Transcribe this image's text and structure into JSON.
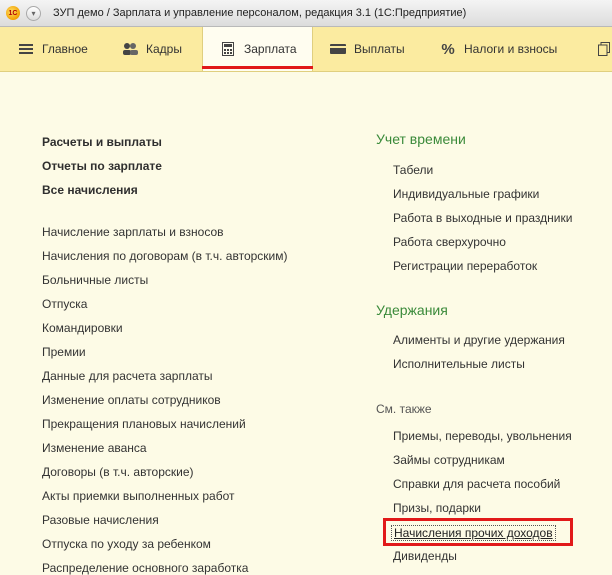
{
  "window": {
    "title": "ЗУП демо / Зарплата и управление персоналом, редакция 3.1  (1С:Предприятие)",
    "logo_text": "1С"
  },
  "sections": [
    {
      "label": "Главное",
      "icon": "hamburger-icon"
    },
    {
      "label": "Кадры",
      "icon": "people-icon"
    },
    {
      "label": "Зарплата",
      "icon": "calculator-icon",
      "active": true
    },
    {
      "label": "Выплаты",
      "icon": "card-icon"
    },
    {
      "label": "Налоги и взносы",
      "icon": "percent-icon"
    }
  ],
  "left_column": {
    "bold_links": [
      "Расчеты и выплаты",
      "Отчеты по зарплате",
      "Все начисления"
    ],
    "links": [
      "Начисление зарплаты и взносов",
      "Начисления по договорам (в т.ч. авторским)",
      "Больничные листы",
      "Отпуска",
      "Командировки",
      "Премии",
      "Данные для расчета зарплаты",
      "Изменение оплаты сотрудников",
      "Прекращения плановых начислений",
      "Изменение аванса",
      "Договоры (в т.ч. авторские)",
      "Акты приемки выполненных работ",
      "Разовые начисления",
      "Отпуска по уходу за ребенком",
      "Распределение основного заработка"
    ]
  },
  "right_column": {
    "time_group": {
      "title": "Учет времени",
      "links": [
        "Табели",
        "Индивидуальные графики",
        "Работа в выходные и праздники",
        "Работа сверхурочно",
        "Регистрации переработок"
      ]
    },
    "deductions_group": {
      "title": "Удержания",
      "links": [
        "Алименты и другие удержания",
        "Исполнительные листы"
      ]
    },
    "see_also": {
      "title": "См. также",
      "links": [
        "Приемы, переводы, увольнения",
        "Займы сотрудникам",
        "Справки для расчета пособий",
        "Призы, подарки"
      ],
      "highlighted": "Начисления прочих доходов",
      "after": [
        "Дивиденды"
      ]
    }
  },
  "colors": {
    "section_bg": "#fbeba0",
    "content_bg": "#fdfbe6",
    "group_title": "#3a8a3a",
    "highlight": "#e11919"
  }
}
